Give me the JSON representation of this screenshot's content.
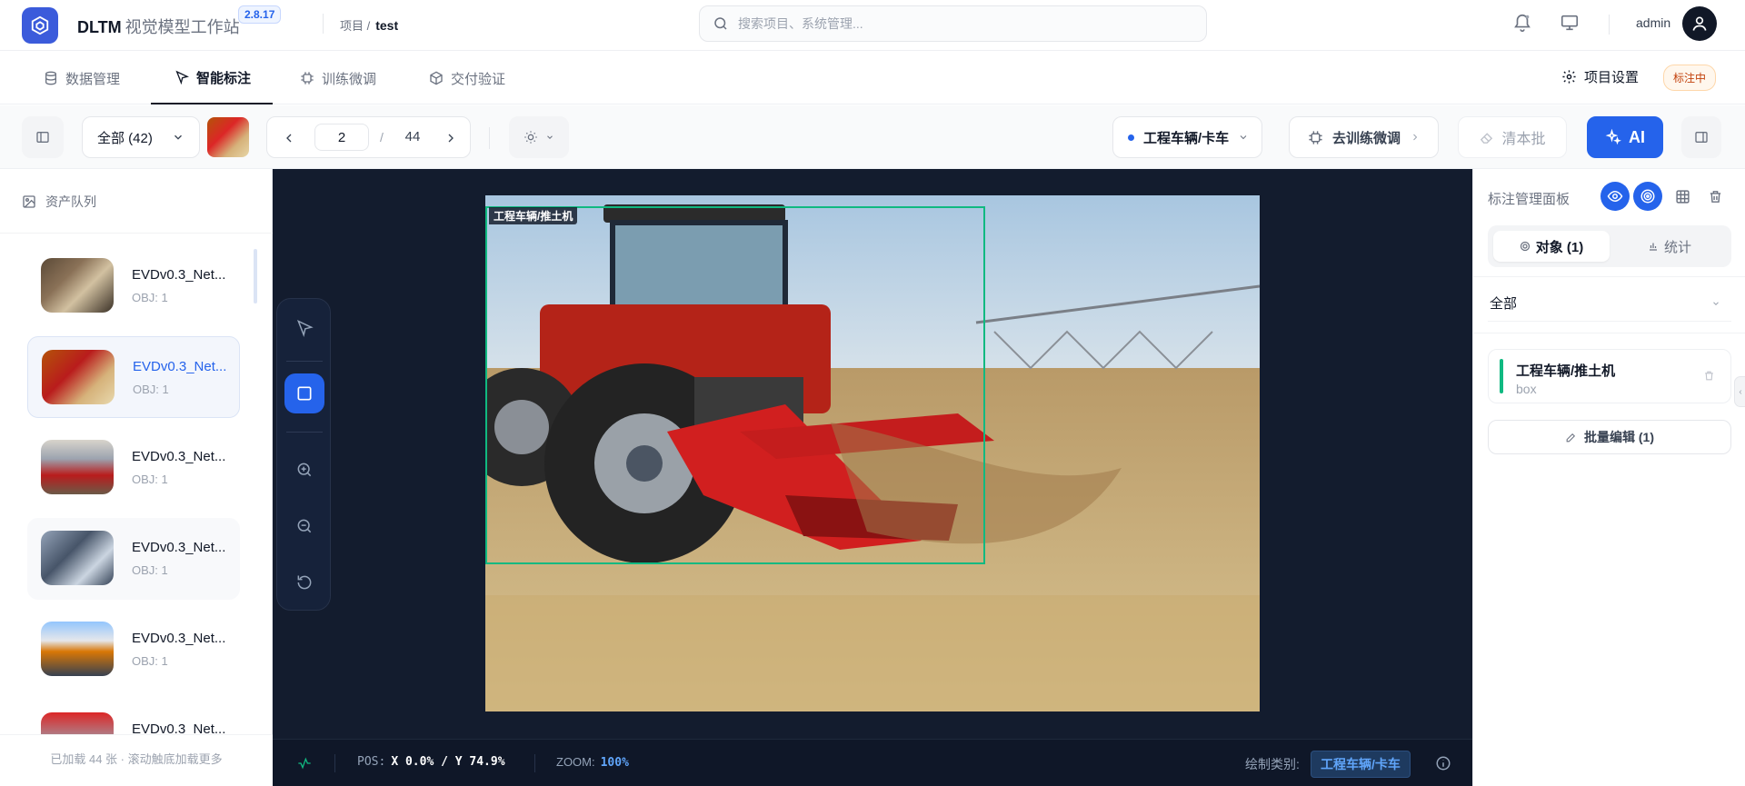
{
  "header": {
    "app_name": "DLTM",
    "app_subtitle": "视觉模型工作站",
    "version": "2.8.17",
    "breadcrumb_label": "项目 /",
    "breadcrumb_project": "test",
    "search_placeholder": "搜索项目、系统管理...",
    "user": "admin",
    "icons": [
      "cube-logo-icon",
      "search-icon",
      "bell-icon",
      "monitor-icon",
      "user-icon"
    ]
  },
  "tabs": [
    {
      "label": "数据管理",
      "icon": "database-icon",
      "active": false
    },
    {
      "label": "智能标注",
      "icon": "cursor-icon",
      "active": true
    },
    {
      "label": "训练微调",
      "icon": "chip-icon",
      "active": false
    },
    {
      "label": "交付验证",
      "icon": "package-icon",
      "active": false
    }
  ],
  "tabbar_right": {
    "settings_label": "项目设置",
    "status_badge": "标注中"
  },
  "toolbar": {
    "filter_label": "全部 (42)",
    "current_page": "2",
    "page_sep": "/",
    "total_pages": "44",
    "class_selector": "工程车辆/卡车",
    "to_train_label": "去训练微调",
    "clear_label": "清本批",
    "ai_label": "AI"
  },
  "sidebar": {
    "title": "资产队列",
    "footer": "已加载 44 张 · 滚动触底加载更多",
    "items": [
      {
        "name": "EVDv0.3_Net...",
        "obj": "OBJ: 1",
        "selected": false
      },
      {
        "name": "EVDv0.3_Net...",
        "obj": "OBJ: 1",
        "selected": true
      },
      {
        "name": "EVDv0.3_Net...",
        "obj": "OBJ: 1",
        "selected": false
      },
      {
        "name": "EVDv0.3_Net...",
        "obj": "OBJ: 1",
        "selected": false
      },
      {
        "name": "EVDv0.3_Net...",
        "obj": "OBJ: 1",
        "selected": false
      },
      {
        "name": "EVDv0.3_Net...",
        "obj": "",
        "selected": false
      }
    ]
  },
  "canvas": {
    "bbox_label": "工程车辆/推土机",
    "tools": [
      "select-cursor-icon",
      "rectangle-tool-icon",
      "zoom-in-icon",
      "zoom-out-icon",
      "reset-view-icon"
    ],
    "active_tool": "rectangle-tool-icon"
  },
  "statusbar": {
    "pos_label": "POS:",
    "pos_value": "X 0.0% / Y 74.9%",
    "zoom_label": "ZOOM:",
    "zoom_value": "100%",
    "class_label": "绘制类别:",
    "class_value": "工程车辆/卡车"
  },
  "right_panel": {
    "title": "标注管理面板",
    "seg_objects": "对象 (1)",
    "seg_stats": "统计",
    "filter": "全部",
    "objects": [
      {
        "name": "工程车辆/推土机",
        "type": "box",
        "color": "#10b981"
      }
    ],
    "batch_edit": "批量编辑 (1)"
  },
  "colors": {
    "accent": "#2563eb",
    "bbox": "#10b981",
    "canvas_bg": "#131c2e"
  }
}
